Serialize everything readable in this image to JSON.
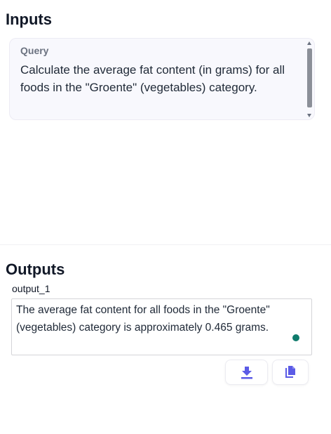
{
  "inputs": {
    "title": "Inputs",
    "query": {
      "label": "Query",
      "value": "Calculate the average fat content (in grams) for all foods in the \"Groente\" (vegetables) category."
    }
  },
  "outputs": {
    "title": "Outputs",
    "items": [
      {
        "label": "output_1",
        "value": "The average fat content for all foods in the \"Groente\" (vegetables) category is approximately 0.465 grams."
      }
    ]
  },
  "actions": {
    "download_icon": "download-icon",
    "copy_icon": "copy-icon"
  },
  "colors": {
    "accent": "#5b5be6",
    "status_dot": "#0f7b6c",
    "card_bg": "#f8f8fd"
  }
}
